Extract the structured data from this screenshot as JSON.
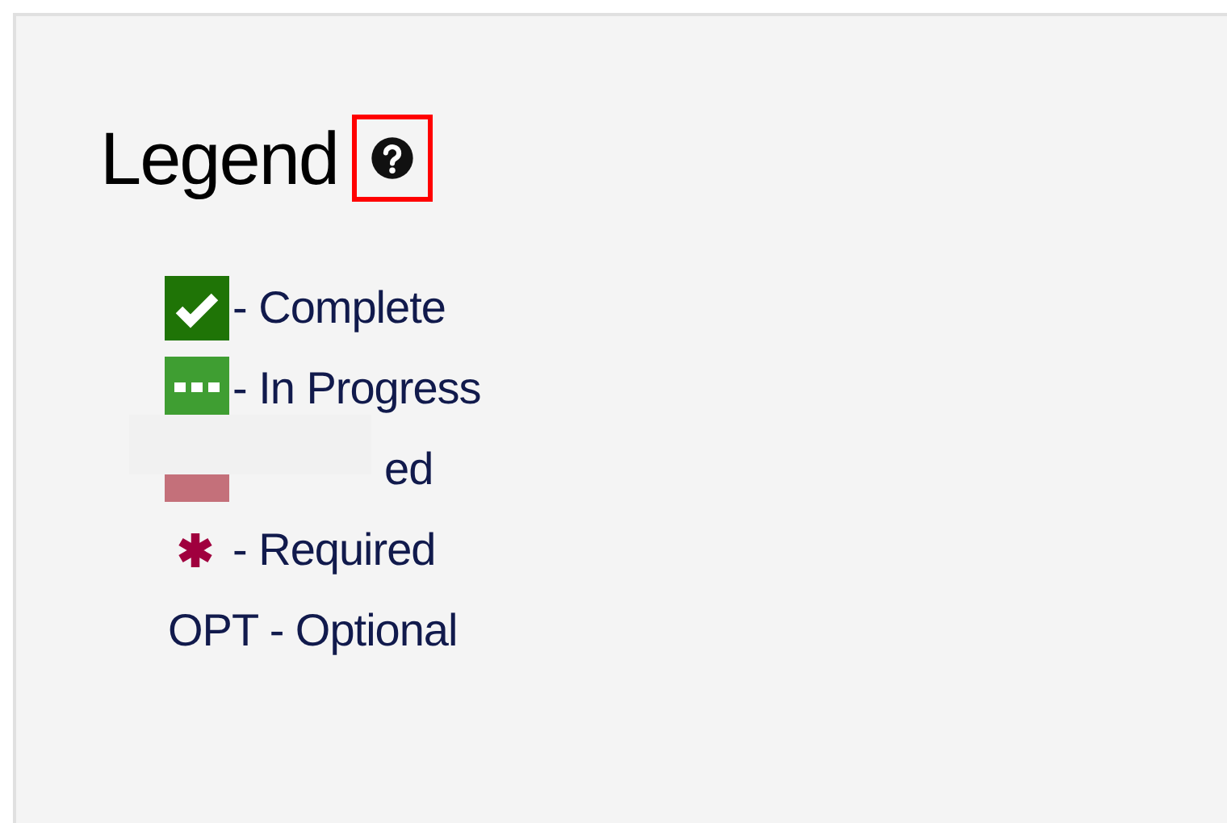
{
  "legend": {
    "title": "Legend",
    "help_highlighted": true,
    "items": [
      {
        "kind": "complete",
        "text": "- Complete"
      },
      {
        "kind": "in_progress",
        "text": "- In Progress"
      },
      {
        "kind": "unfulfilled",
        "text": "ed"
      },
      {
        "kind": "required",
        "text": "- Required"
      },
      {
        "kind": "optional",
        "abbr": "OPT",
        "text": "- Optional"
      }
    ]
  }
}
